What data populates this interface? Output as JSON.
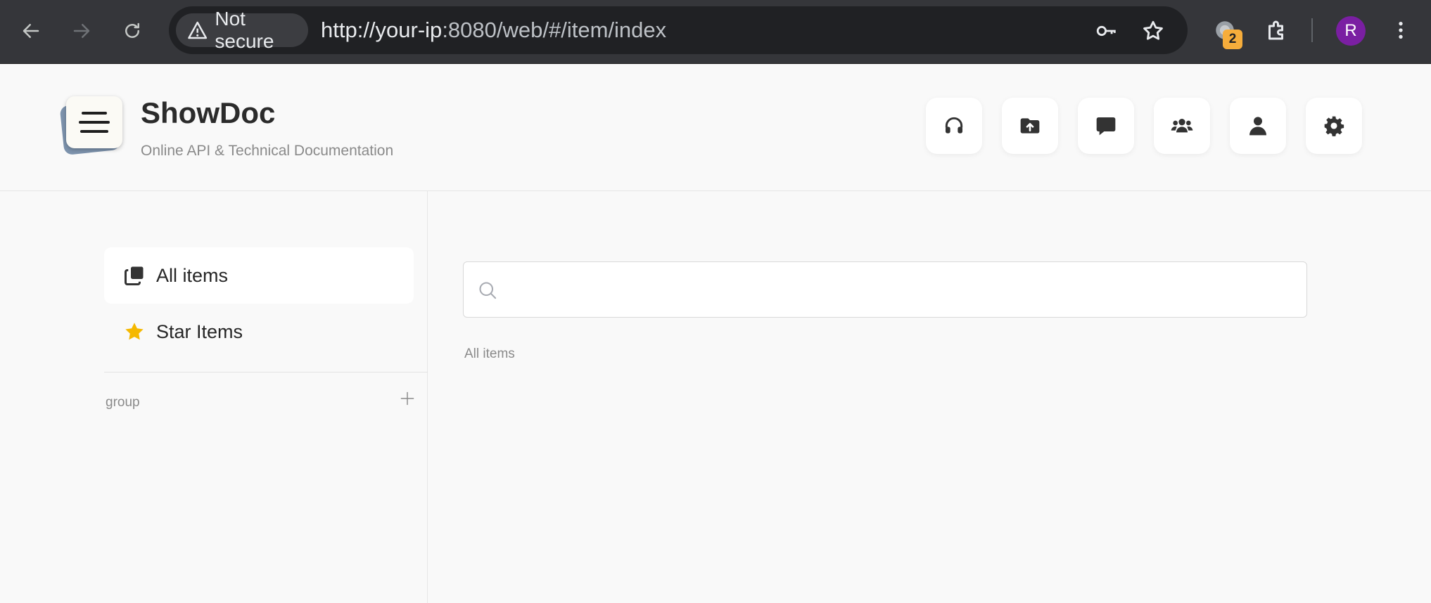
{
  "browser": {
    "security_label": "Not secure",
    "url_host": "http://your-ip",
    "url_rest": ":8080/web/#/item/index",
    "extension_badge": "2",
    "profile_initial": "R",
    "accent_color": "#7a1fa2"
  },
  "header": {
    "title": "ShowDoc",
    "subtitle": "Online API & Technical Documentation",
    "actions": [
      {
        "icon": "headset-icon"
      },
      {
        "icon": "folder-upload-icon"
      },
      {
        "icon": "comment-icon"
      },
      {
        "icon": "users-icon"
      },
      {
        "icon": "user-icon"
      },
      {
        "icon": "gear-icon"
      }
    ]
  },
  "sidebar": {
    "items": [
      {
        "label": "All items",
        "icon": "copy-icon",
        "active": true
      },
      {
        "label": "Star Items",
        "icon": "star-icon",
        "active": false
      }
    ],
    "group_label": "group",
    "star_color": "#f5b800"
  },
  "main": {
    "search_placeholder": "",
    "section_label": "All items"
  }
}
